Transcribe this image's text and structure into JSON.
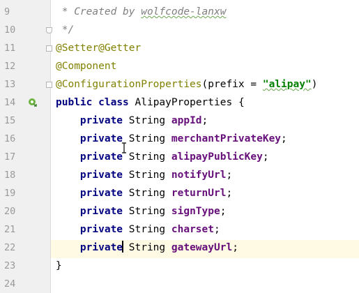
{
  "editor": {
    "line_numbers": [
      "9",
      "10",
      "11",
      "12",
      "13",
      "14",
      "15",
      "16",
      "17",
      "18",
      "19",
      "20",
      "21",
      "22",
      "23",
      "24"
    ],
    "current_line": "22",
    "lines": {
      "l9": {
        "comment": " * Created by ",
        "author": "wolfcode-lanxw"
      },
      "l10": {
        "comment": " */"
      },
      "l11": {
        "annotation": "@Setter@Getter"
      },
      "l12": {
        "annotation": "@Component"
      },
      "l13": {
        "annotation": "@ConfigurationProperties",
        "open": "(",
        "attr": "prefix",
        "eq": " = ",
        "value": "\"alipay\"",
        "close": ")"
      },
      "l14": {
        "kw1": "public",
        "kw2": "class",
        "classname": "AlipayProperties",
        "brace": "{"
      },
      "l15": {
        "kw": "private",
        "type": "String",
        "field": "appId",
        "semi": ";"
      },
      "l16": {
        "kw": "private",
        "type": "String",
        "field": "merchantPrivateKey",
        "semi": ";"
      },
      "l17": {
        "kw": "private",
        "type": "String",
        "field": "alipayPublicKey",
        "semi": ";"
      },
      "l18": {
        "kw": "private",
        "type": "String",
        "field": "notifyUrl",
        "semi": ";"
      },
      "l19": {
        "kw": "private",
        "type": "String",
        "field": "returnUrl",
        "semi": ";"
      },
      "l20": {
        "kw": "private",
        "type": "String",
        "field": "signType",
        "semi": ";"
      },
      "l21": {
        "kw": "private",
        "type": "String",
        "field": "charset",
        "semi": ";"
      },
      "l22": {
        "kw": "private",
        "type": "String",
        "field": "gatewayUrl",
        "semi": ";"
      },
      "l23": {
        "brace": "}"
      }
    },
    "icons": {
      "line14": "spring-bean-icon",
      "line11_fold": "fold-marker-icon",
      "line13_fold": "fold-marker-icon",
      "line10_fold": "fold-end-icon"
    },
    "colors": {
      "keyword": "#000080",
      "field": "#660e7a",
      "annotation": "#808000",
      "string": "#008000",
      "comment": "#808080",
      "current_line_bg": "#fffae3",
      "gutter_bg": "#f0f0f0"
    }
  }
}
